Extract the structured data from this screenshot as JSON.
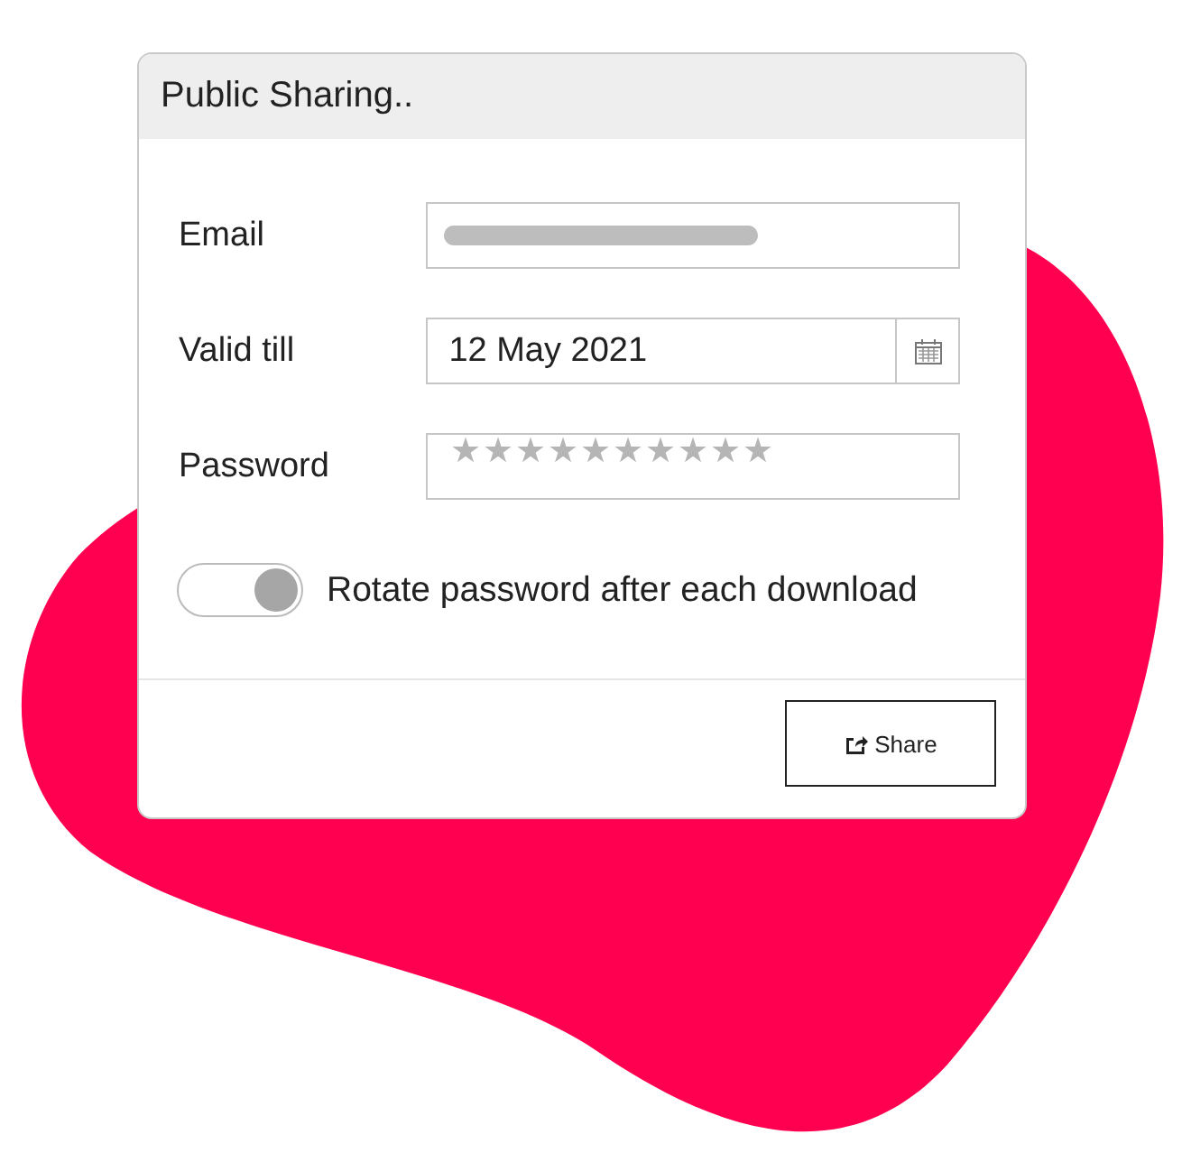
{
  "dialog": {
    "title": "Public Sharing.."
  },
  "fields": [
    {
      "kind": "redacted",
      "label": "Email"
    },
    {
      "kind": "date",
      "label": "Valid till",
      "value": "12 May 2021"
    },
    {
      "kind": "password",
      "label": "Password",
      "value": "★★★★★★★★★★"
    }
  ],
  "toggle": {
    "label": "Rotate password after each download",
    "on": true
  },
  "buttons": [
    {
      "label": "Share"
    }
  ]
}
